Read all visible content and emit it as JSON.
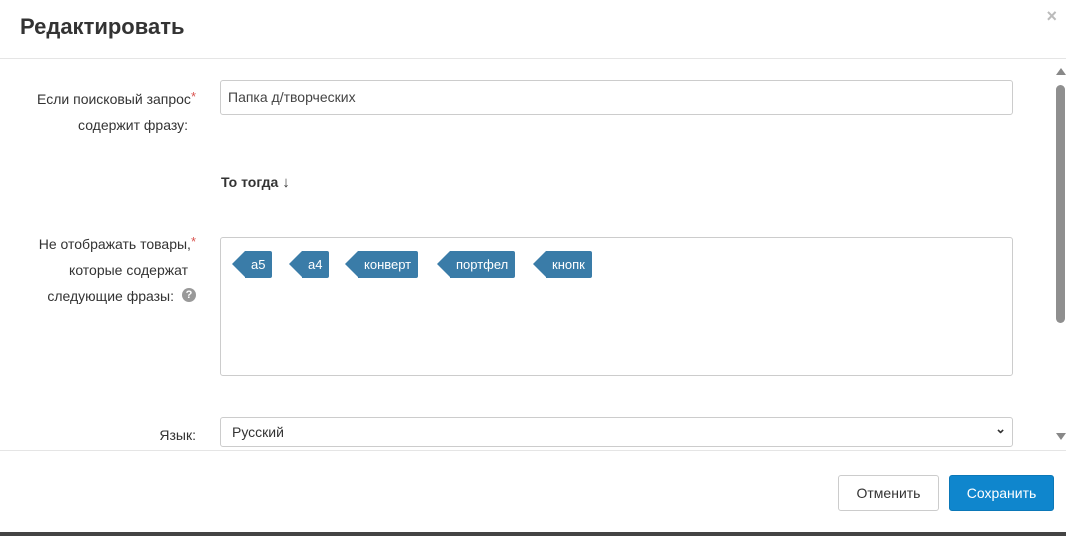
{
  "dialog": {
    "title": "Редактировать",
    "close_glyph": "×"
  },
  "form": {
    "query_label_line1": "Если поисковый запрос",
    "query_label_line2": "содержит фразу:",
    "required_mark": "*",
    "query_value": "Папка д/творческих",
    "then_text": "То тогда",
    "then_arrow": "↓",
    "exclude_label_line1": "Не отображать товары,",
    "exclude_label_line2": "которые содержат",
    "exclude_label_line3": "следующие фразы:",
    "help_glyph": "?",
    "tags": [
      "а5",
      "а4",
      "конверт",
      "портфел",
      "кнопк"
    ],
    "language_label": "Язык:",
    "language_value": "Русский"
  },
  "footer": {
    "cancel_label": "Отменить",
    "save_label": "Сохранить"
  },
  "colors": {
    "tag_bg": "#3a7ca8",
    "primary": "#0f86cd",
    "required": "#d9534f"
  }
}
